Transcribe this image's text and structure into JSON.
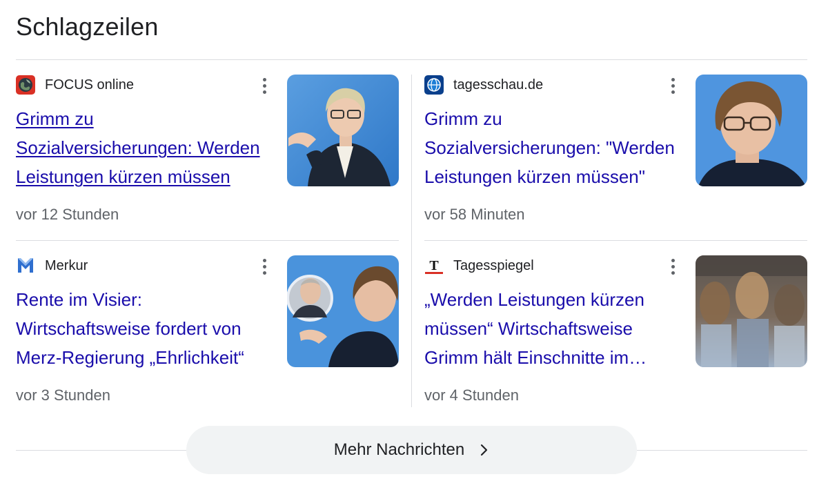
{
  "section": {
    "title": "Schlagzeilen"
  },
  "cards": [
    {
      "source": "FOCUS online",
      "source_icon": "focus-globe-icon",
      "headline": "Grimm zu Sozialversicherungen: Werden Leistungen kürzen müssen",
      "time": "vor 12 Stunden",
      "thumbnail": "woman-gesturing-blue-backdrop-photo"
    },
    {
      "source": "tagesschau.de",
      "source_icon": "tagesschau-globe-icon",
      "headline": "Grimm zu Sozialversicherungen: \"Werden Leistungen kürzen müssen\"",
      "time": "vor 58 Minuten",
      "thumbnail": "woman-with-glasses-portrait-photo"
    },
    {
      "source": "Merkur",
      "source_icon": "merkur-m-icon",
      "headline": "Rente im Visier: Wirtschaftsweise fordert von Merz-Regierung „Ehrlichkeit“",
      "time": "vor 3 Stunden",
      "thumbnail": "merz-and-grimm-composite-photo"
    },
    {
      "source": "Tagesspiegel",
      "source_icon": "tagesspiegel-t-icon",
      "headline": "„Werden Leistungen kürzen müssen“ Wirtschaftsweise Grimm hält Einschnitte im Sozialsystem für nötig",
      "time": "vor 4 Stunden",
      "thumbnail": "blurred-crowd-photo"
    }
  ],
  "footer": {
    "more_label": "Mehr Nachrichten"
  },
  "colors": {
    "link": "#1a0dab",
    "meta": "#5f6368",
    "divider": "#dadce0",
    "button_bg": "#f1f3f4"
  }
}
